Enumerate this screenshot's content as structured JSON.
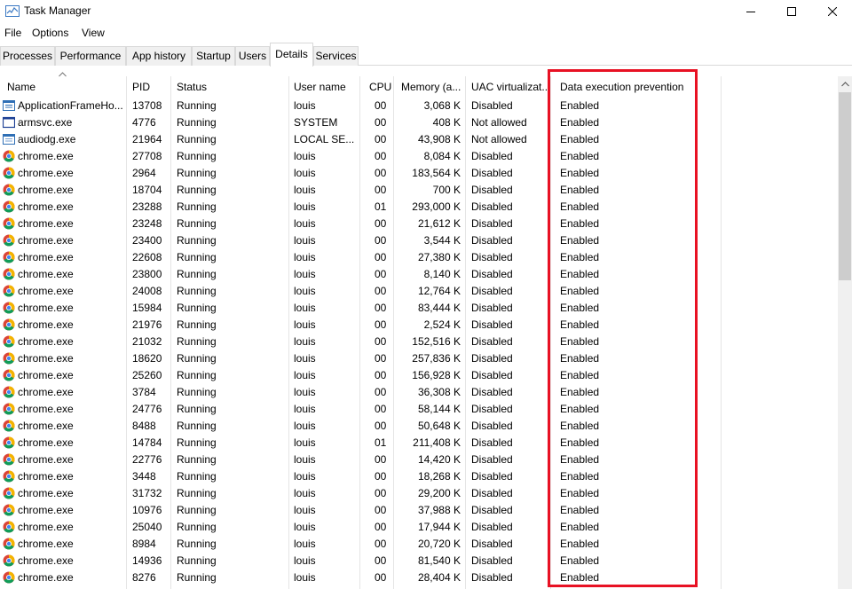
{
  "window": {
    "title": "Task Manager"
  },
  "menu": [
    "File",
    "Options",
    "View"
  ],
  "tabs": [
    "Processes",
    "Performance",
    "App history",
    "Startup",
    "Users",
    "Details",
    "Services"
  ],
  "active_tab": "Details",
  "columns": {
    "name": "Name",
    "pid": "PID",
    "status": "Status",
    "user": "User name",
    "cpu": "CPU",
    "memory": "Memory (a...",
    "uac": "UAC virtualizat...",
    "dep": "Data execution prevention"
  },
  "sort_column": "name",
  "highlight_color": "#e81123",
  "rows": [
    {
      "icon": "app-frame-icon",
      "name": "ApplicationFrameHo...",
      "pid": "13708",
      "status": "Running",
      "user": "louis",
      "cpu": "00",
      "memory": "3,068 K",
      "uac": "Disabled",
      "dep": "Enabled"
    },
    {
      "icon": "service-window-icon",
      "name": "armsvc.exe",
      "pid": "4776",
      "status": "Running",
      "user": "SYSTEM",
      "cpu": "00",
      "memory": "408 K",
      "uac": "Not allowed",
      "dep": "Enabled"
    },
    {
      "icon": "audio-window-icon",
      "name": "audiodg.exe",
      "pid": "21964",
      "status": "Running",
      "user": "LOCAL SE...",
      "cpu": "00",
      "memory": "43,908 K",
      "uac": "Not allowed",
      "dep": "Enabled"
    },
    {
      "icon": "chrome-icon",
      "name": "chrome.exe",
      "pid": "27708",
      "status": "Running",
      "user": "louis",
      "cpu": "00",
      "memory": "8,084 K",
      "uac": "Disabled",
      "dep": "Enabled"
    },
    {
      "icon": "chrome-icon",
      "name": "chrome.exe",
      "pid": "2964",
      "status": "Running",
      "user": "louis",
      "cpu": "00",
      "memory": "183,564 K",
      "uac": "Disabled",
      "dep": "Enabled"
    },
    {
      "icon": "chrome-icon",
      "name": "chrome.exe",
      "pid": "18704",
      "status": "Running",
      "user": "louis",
      "cpu": "00",
      "memory": "700 K",
      "uac": "Disabled",
      "dep": "Enabled"
    },
    {
      "icon": "chrome-icon",
      "name": "chrome.exe",
      "pid": "23288",
      "status": "Running",
      "user": "louis",
      "cpu": "01",
      "memory": "293,000 K",
      "uac": "Disabled",
      "dep": "Enabled"
    },
    {
      "icon": "chrome-icon",
      "name": "chrome.exe",
      "pid": "23248",
      "status": "Running",
      "user": "louis",
      "cpu": "00",
      "memory": "21,612 K",
      "uac": "Disabled",
      "dep": "Enabled"
    },
    {
      "icon": "chrome-icon",
      "name": "chrome.exe",
      "pid": "23400",
      "status": "Running",
      "user": "louis",
      "cpu": "00",
      "memory": "3,544 K",
      "uac": "Disabled",
      "dep": "Enabled"
    },
    {
      "icon": "chrome-icon",
      "name": "chrome.exe",
      "pid": "22608",
      "status": "Running",
      "user": "louis",
      "cpu": "00",
      "memory": "27,380 K",
      "uac": "Disabled",
      "dep": "Enabled"
    },
    {
      "icon": "chrome-icon",
      "name": "chrome.exe",
      "pid": "23800",
      "status": "Running",
      "user": "louis",
      "cpu": "00",
      "memory": "8,140 K",
      "uac": "Disabled",
      "dep": "Enabled"
    },
    {
      "icon": "chrome-icon",
      "name": "chrome.exe",
      "pid": "24008",
      "status": "Running",
      "user": "louis",
      "cpu": "00",
      "memory": "12,764 K",
      "uac": "Disabled",
      "dep": "Enabled"
    },
    {
      "icon": "chrome-icon",
      "name": "chrome.exe",
      "pid": "15984",
      "status": "Running",
      "user": "louis",
      "cpu": "00",
      "memory": "83,444 K",
      "uac": "Disabled",
      "dep": "Enabled"
    },
    {
      "icon": "chrome-icon",
      "name": "chrome.exe",
      "pid": "21976",
      "status": "Running",
      "user": "louis",
      "cpu": "00",
      "memory": "2,524 K",
      "uac": "Disabled",
      "dep": "Enabled"
    },
    {
      "icon": "chrome-icon",
      "name": "chrome.exe",
      "pid": "21032",
      "status": "Running",
      "user": "louis",
      "cpu": "00",
      "memory": "152,516 K",
      "uac": "Disabled",
      "dep": "Enabled"
    },
    {
      "icon": "chrome-icon",
      "name": "chrome.exe",
      "pid": "18620",
      "status": "Running",
      "user": "louis",
      "cpu": "00",
      "memory": "257,836 K",
      "uac": "Disabled",
      "dep": "Enabled"
    },
    {
      "icon": "chrome-icon",
      "name": "chrome.exe",
      "pid": "25260",
      "status": "Running",
      "user": "louis",
      "cpu": "00",
      "memory": "156,928 K",
      "uac": "Disabled",
      "dep": "Enabled"
    },
    {
      "icon": "chrome-icon",
      "name": "chrome.exe",
      "pid": "3784",
      "status": "Running",
      "user": "louis",
      "cpu": "00",
      "memory": "36,308 K",
      "uac": "Disabled",
      "dep": "Enabled"
    },
    {
      "icon": "chrome-icon",
      "name": "chrome.exe",
      "pid": "24776",
      "status": "Running",
      "user": "louis",
      "cpu": "00",
      "memory": "58,144 K",
      "uac": "Disabled",
      "dep": "Enabled"
    },
    {
      "icon": "chrome-icon",
      "name": "chrome.exe",
      "pid": "8488",
      "status": "Running",
      "user": "louis",
      "cpu": "00",
      "memory": "50,648 K",
      "uac": "Disabled",
      "dep": "Enabled"
    },
    {
      "icon": "chrome-icon",
      "name": "chrome.exe",
      "pid": "14784",
      "status": "Running",
      "user": "louis",
      "cpu": "01",
      "memory": "211,408 K",
      "uac": "Disabled",
      "dep": "Enabled"
    },
    {
      "icon": "chrome-icon",
      "name": "chrome.exe",
      "pid": "22776",
      "status": "Running",
      "user": "louis",
      "cpu": "00",
      "memory": "14,420 K",
      "uac": "Disabled",
      "dep": "Enabled"
    },
    {
      "icon": "chrome-icon",
      "name": "chrome.exe",
      "pid": "3448",
      "status": "Running",
      "user": "louis",
      "cpu": "00",
      "memory": "18,268 K",
      "uac": "Disabled",
      "dep": "Enabled"
    },
    {
      "icon": "chrome-icon",
      "name": "chrome.exe",
      "pid": "31732",
      "status": "Running",
      "user": "louis",
      "cpu": "00",
      "memory": "29,200 K",
      "uac": "Disabled",
      "dep": "Enabled"
    },
    {
      "icon": "chrome-icon",
      "name": "chrome.exe",
      "pid": "10976",
      "status": "Running",
      "user": "louis",
      "cpu": "00",
      "memory": "37,988 K",
      "uac": "Disabled",
      "dep": "Enabled"
    },
    {
      "icon": "chrome-icon",
      "name": "chrome.exe",
      "pid": "25040",
      "status": "Running",
      "user": "louis",
      "cpu": "00",
      "memory": "17,944 K",
      "uac": "Disabled",
      "dep": "Enabled"
    },
    {
      "icon": "chrome-icon",
      "name": "chrome.exe",
      "pid": "8984",
      "status": "Running",
      "user": "louis",
      "cpu": "00",
      "memory": "20,720 K",
      "uac": "Disabled",
      "dep": "Enabled"
    },
    {
      "icon": "chrome-icon",
      "name": "chrome.exe",
      "pid": "14936",
      "status": "Running",
      "user": "louis",
      "cpu": "00",
      "memory": "81,540 K",
      "uac": "Disabled",
      "dep": "Enabled"
    },
    {
      "icon": "chrome-icon",
      "name": "chrome.exe",
      "pid": "8276",
      "status": "Running",
      "user": "louis",
      "cpu": "00",
      "memory": "28,404 K",
      "uac": "Disabled",
      "dep": "Enabled"
    }
  ]
}
